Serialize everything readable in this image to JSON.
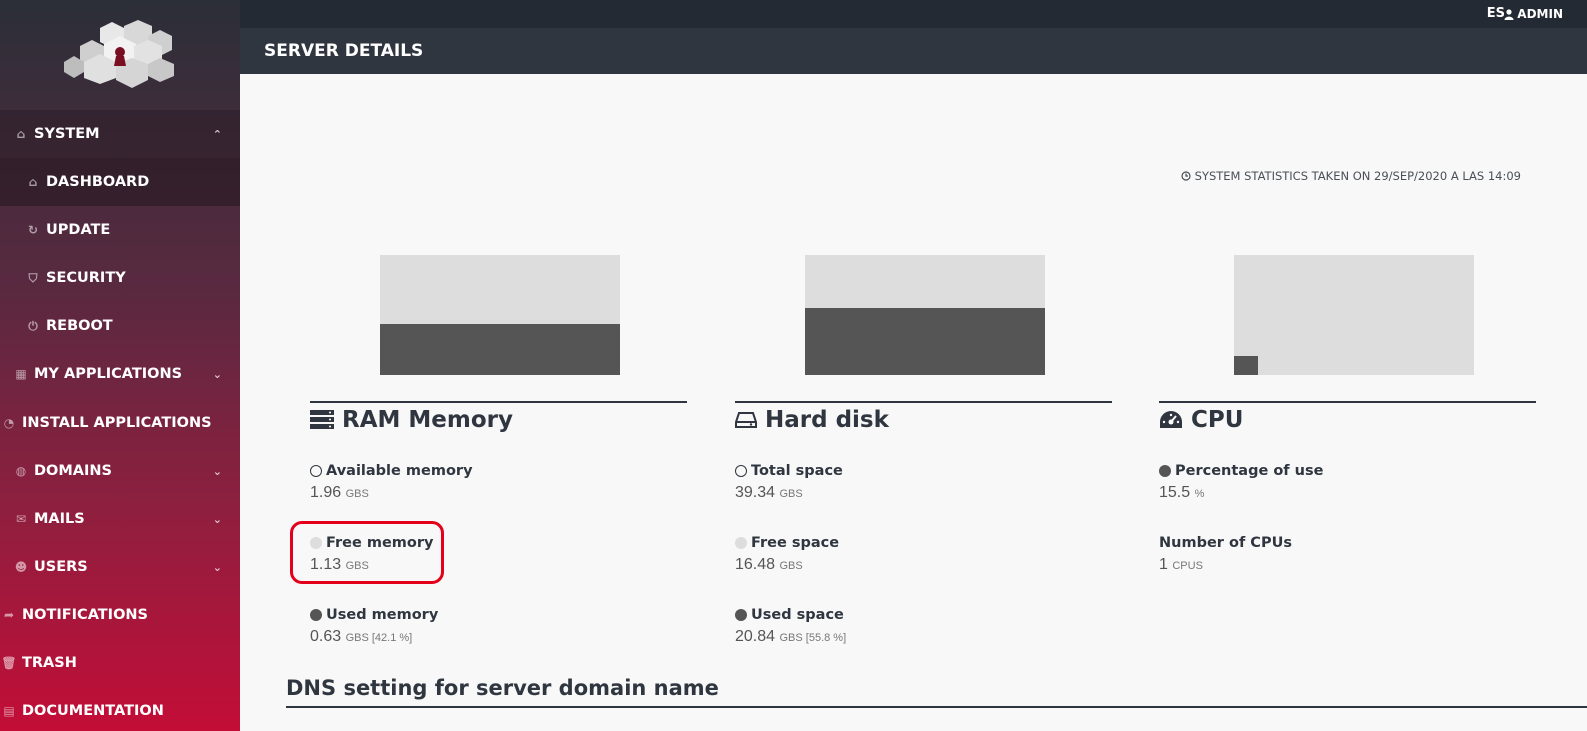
{
  "topbar": {
    "lang": "ES",
    "user": "ADMIN"
  },
  "header": {
    "title": "SERVER DETAILS"
  },
  "sidebar": {
    "items": [
      {
        "label": "SYSTEM"
      },
      {
        "label": "DASHBOARD"
      },
      {
        "label": "UPDATE"
      },
      {
        "label": "SECURITY"
      },
      {
        "label": "REBOOT"
      },
      {
        "label": "MY APPLICATIONS"
      },
      {
        "label": "INSTALL APPLICATIONS"
      },
      {
        "label": "DOMAINS"
      },
      {
        "label": "MAILS"
      },
      {
        "label": "USERS"
      },
      {
        "label": "NOTIFICATIONS"
      },
      {
        "label": "TRASH"
      },
      {
        "label": "DOCUMENTATION"
      }
    ]
  },
  "stats_timestamp": "SYSTEM STATISTICS TAKEN ON 29/SEP/2020 A LAS 14:09",
  "gauges": {
    "ram_used_fraction": 0.421,
    "disk_used_fraction": 0.558,
    "cpu_use_fraction": 0.155
  },
  "ram": {
    "title": "RAM Memory",
    "available_label": "Available memory",
    "available_value": "1.96",
    "available_unit": "GBS",
    "free_label": "Free memory",
    "free_value": "1.13",
    "free_unit": "GBS",
    "used_label": "Used memory",
    "used_value": "0.63",
    "used_unit": "GBS [42.1 %]"
  },
  "disk": {
    "title": "Hard disk",
    "total_label": "Total space",
    "total_value": "39.34",
    "total_unit": "GBS",
    "free_label": "Free space",
    "free_value": "16.48",
    "free_unit": "GBS",
    "used_label": "Used space",
    "used_value": "20.84",
    "used_unit": "GBS [55.8 %]"
  },
  "cpu": {
    "title": "CPU",
    "use_label": "Percentage of use",
    "use_value": "15.5",
    "use_unit": "%",
    "count_label": "Number of CPUs",
    "count_value": "1",
    "count_unit": "CPUS"
  },
  "dns": {
    "title": "DNS setting for server domain name"
  }
}
